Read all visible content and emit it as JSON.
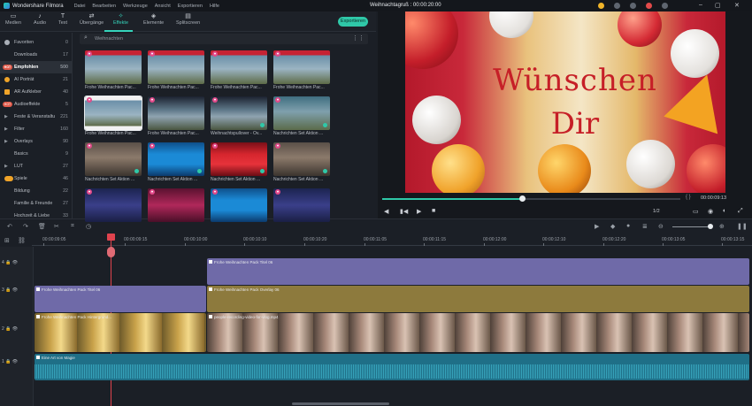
{
  "app": {
    "name": "Wondershare Filmora",
    "menu": [
      "Datei",
      "Bearbeiten",
      "Werkzeuge",
      "Ansicht",
      "Exportieren",
      "Hilfe"
    ],
    "doc_title": "Weihnachtagruß : 00:00:20:00"
  },
  "toolbar": {
    "tabs": [
      {
        "label": "Medien",
        "icon": "folder-icon"
      },
      {
        "label": "Audio",
        "icon": "music-note-icon"
      },
      {
        "label": "Text",
        "icon": "text-T-icon"
      },
      {
        "label": "Übergänge",
        "icon": "transition-icon"
      },
      {
        "label": "Effekte",
        "icon": "effects-icon"
      },
      {
        "label": "Elemente",
        "icon": "elements-icon"
      },
      {
        "label": "Splitscreen",
        "icon": "splitscreen-icon"
      }
    ],
    "active": "Effekte",
    "export_label": "Exportieren"
  },
  "sidebar": {
    "items": [
      {
        "label": "Favoriten",
        "count": "0",
        "icon": "heart"
      },
      {
        "label": "Downloads",
        "count": "17",
        "icon": ""
      },
      {
        "label": "Empfohlen",
        "count": "500",
        "icon": "hot",
        "selected": true
      },
      {
        "label": "AI Porträt",
        "count": "21",
        "icon": "ai"
      },
      {
        "label": "AR Aufkleber",
        "count": "40",
        "icon": "ar"
      },
      {
        "label": "Audioeffekte",
        "count": "5",
        "icon": "hot"
      },
      {
        "label": "Feste & Veranstaltu",
        "count": "221",
        "icon": "arrow"
      },
      {
        "label": "Filter",
        "count": "160",
        "icon": "arrow"
      },
      {
        "label": "Overlays",
        "count": "90",
        "icon": "arrow"
      },
      {
        "label": "Basics",
        "count": "9",
        "icon": ""
      },
      {
        "label": "LUT",
        "count": "27",
        "icon": "arrow"
      },
      {
        "label": "Spiele",
        "count": "46",
        "icon": "game"
      },
      {
        "label": "Bildung",
        "count": "22",
        "icon": ""
      },
      {
        "label": "Familie & Freunde",
        "count": "27",
        "icon": ""
      },
      {
        "label": "Hochzeit & Liebe",
        "count": "33",
        "icon": ""
      }
    ]
  },
  "search": {
    "placeholder": "Weihnachten"
  },
  "effects": [
    {
      "label": "Frohe Weihnachten Pac...",
      "theme": "xmas"
    },
    {
      "label": "Frohe Weihnachten Pac...",
      "theme": "xmas"
    },
    {
      "label": "Frohe Weihnachten Pac...",
      "theme": "xmas"
    },
    {
      "label": "Frohe Weihnachten Pac...",
      "theme": "xmas"
    },
    {
      "label": "Frohe Weihnachten Pac...",
      "theme": "white"
    },
    {
      "label": "Frohe Weihnachten Pac...",
      "theme": "dark"
    },
    {
      "label": "Weihnachtspullover - Ov...",
      "theme": "dark"
    },
    {
      "label": "Nachrichten Set Aktion ...",
      "theme": "teal"
    },
    {
      "label": "Nachrichten Set Aktion ...",
      "theme": "room"
    },
    {
      "label": "Nachrichten Set Aktion ...",
      "theme": "blue"
    },
    {
      "label": "Nachrichten Set Aktion ...",
      "theme": "red"
    },
    {
      "label": "Nachrichten Set Aktion ...",
      "theme": "room"
    },
    {
      "label": "",
      "theme": "purple"
    },
    {
      "label": "",
      "theme": "pink"
    },
    {
      "label": "",
      "theme": "blue"
    },
    {
      "label": "",
      "theme": "purple"
    }
  ],
  "preview": {
    "line1": "Wünschen",
    "line2": "Dir",
    "timecode": "00:00:09:13",
    "ratio": "1/2",
    "progress": 0.47
  },
  "timeline": {
    "ruler": [
      "00:00:09:05",
      "00:00:09:15",
      "00:00:10:00",
      "00:00:10:10",
      "00:00:10:20",
      "00:00:11:05",
      "00:00:11:15",
      "00:00:12:00",
      "00:00:12:10",
      "00:00:12:20",
      "00:00:13:05",
      "00:00:13:15"
    ],
    "clips": {
      "t4a": "Frohe Weihnachten Pack Titel 06",
      "t3a": "Frohe Weihnachten Pack Titel 06",
      "t3b": "Frohe Weihnachten Pack Overlay 06",
      "v2a": "Frohe Weihnachten Pack Hintergrund...",
      "v2b": "people-recording-video-for-vlog.mp4",
      "audio": "Eine Art von Magie"
    },
    "tracks": [
      "4",
      "3",
      "2",
      "1"
    ]
  }
}
